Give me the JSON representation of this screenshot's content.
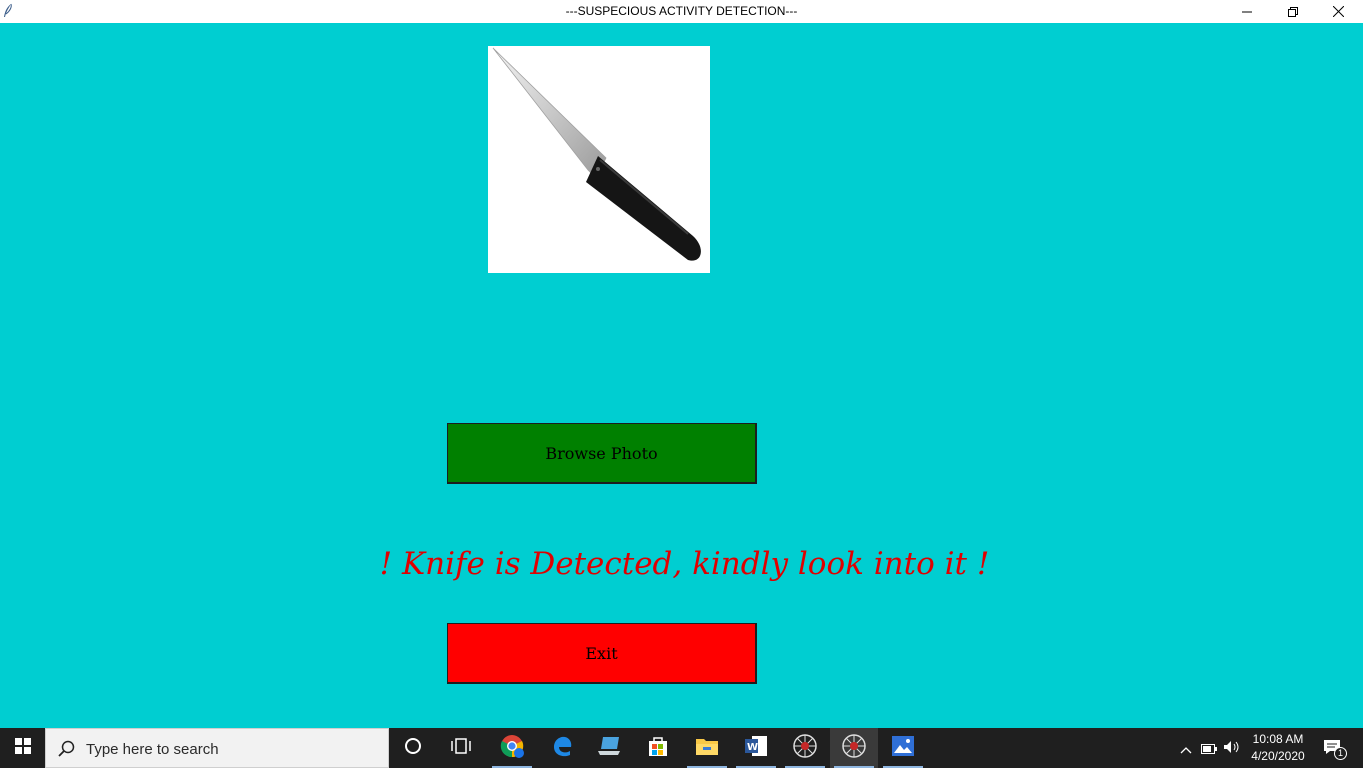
{
  "window": {
    "title": "---SUSPECIOUS ACTIVITY DETECTION---",
    "minimize_icon": "minimize-icon",
    "restore_icon": "restore-icon",
    "close_icon": "close-icon"
  },
  "main": {
    "photo_subject": "knife",
    "browse_label": "Browse Photo",
    "alert_text": "! Knife is Detected, kindly look into it !",
    "exit_label": "Exit",
    "colors": {
      "background": "#00ced1",
      "browse_button": "#008000",
      "exit_button": "#ff0000",
      "alert_text": "#e00000"
    }
  },
  "taskbar": {
    "search_placeholder": "Type here to search",
    "apps": [
      "cortana-icon",
      "task-view-icon",
      "chrome-icon",
      "edge-icon",
      "laptop-icon",
      "store-icon",
      "file-explorer-icon",
      "word-icon",
      "spider-app-icon",
      "spider-app-icon",
      "photos-icon"
    ],
    "time": "10:08 AM",
    "date": "4/20/2020",
    "notification_count": "1"
  }
}
